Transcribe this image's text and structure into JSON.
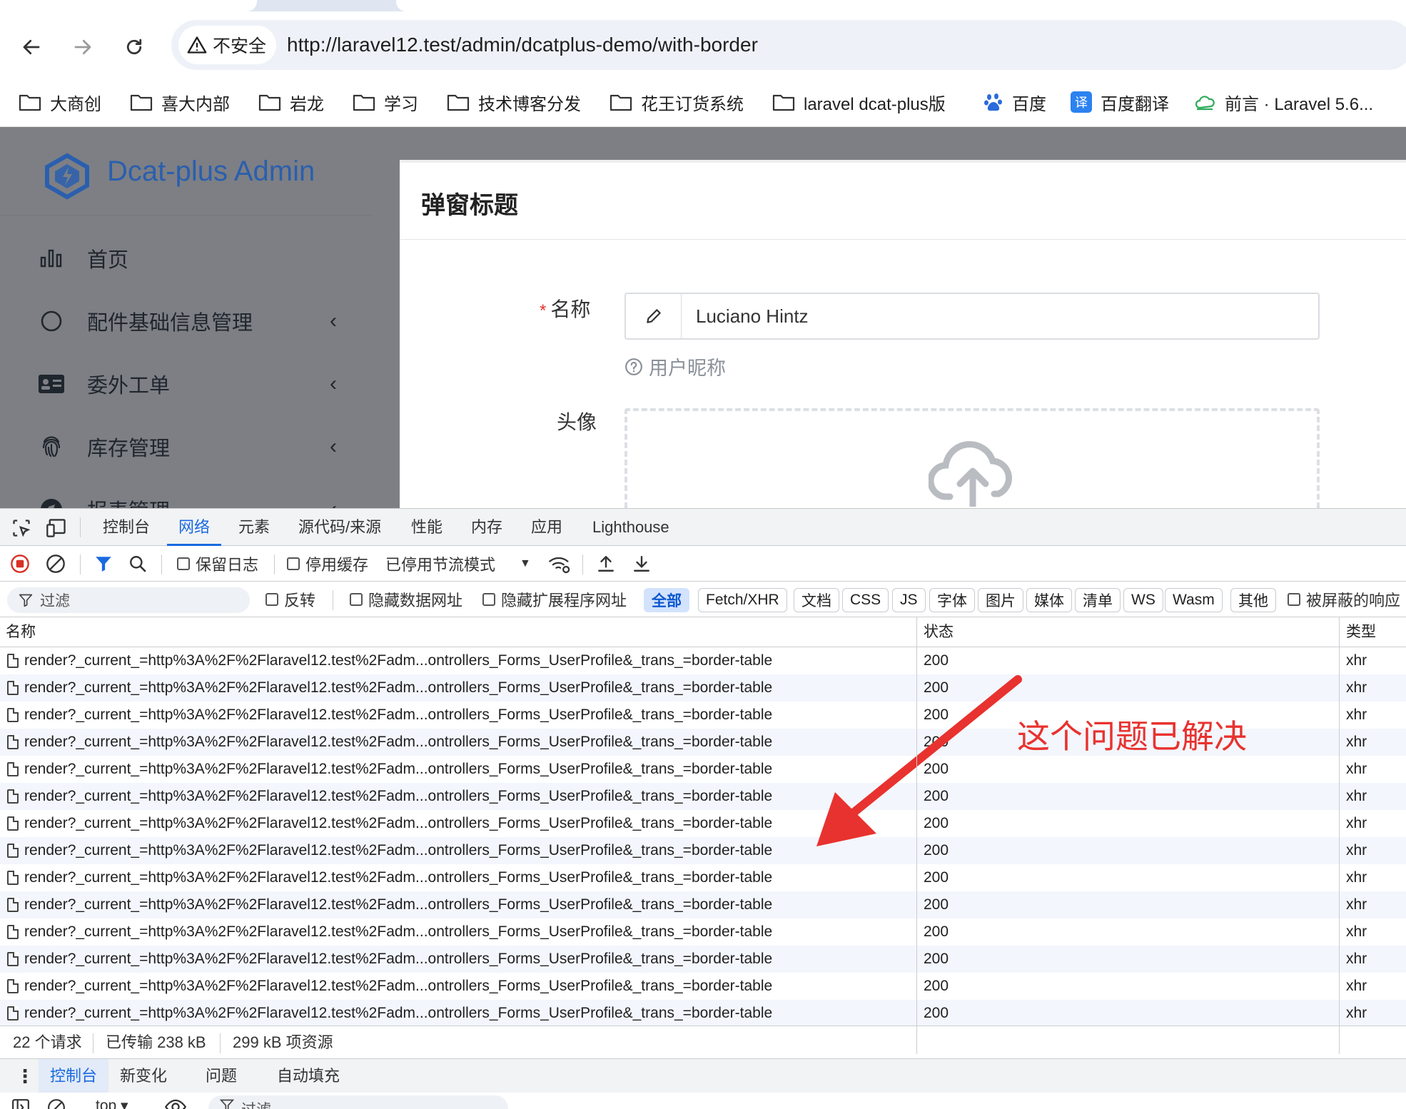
{
  "browser": {
    "security_label": "不安全",
    "url": "http://laravel12.test/admin/dcatplus-demo/with-border",
    "bookmarks": [
      {
        "label": "大商创",
        "icon": "folder-icon"
      },
      {
        "label": "喜大内部",
        "icon": "folder-icon"
      },
      {
        "label": "岩龙",
        "icon": "folder-icon"
      },
      {
        "label": "学习",
        "icon": "folder-icon"
      },
      {
        "label": "技术博客分发",
        "icon": "folder-icon"
      },
      {
        "label": "花王订货系统",
        "icon": "folder-icon"
      },
      {
        "label": "laravel dcat-plus版",
        "icon": "folder-icon"
      },
      {
        "label": "百度",
        "icon": "baidu-icon"
      },
      {
        "label": "百度翻译",
        "icon": "translate-icon"
      },
      {
        "label": "前言 · Laravel 5.6...",
        "icon": "cloud-icon"
      }
    ]
  },
  "app": {
    "brand": "Dcat-plus Admin",
    "menu": [
      {
        "label": "首页",
        "icon": "bar-chart-icon",
        "has_children": false
      },
      {
        "label": "配件基础信息管理",
        "icon": "circle-icon",
        "has_children": true
      },
      {
        "label": "委外工单",
        "icon": "id-card-icon",
        "has_children": true
      },
      {
        "label": "库存管理",
        "icon": "fingerprint-icon",
        "has_children": true
      },
      {
        "label": "报表管理",
        "icon": "compass-icon",
        "has_children": true
      }
    ],
    "chevron": "‹"
  },
  "modal": {
    "title": "弹窗标题",
    "name_label": "名称",
    "required_mark": "*",
    "name_value": "Luciano Hintz",
    "help_text": "用户昵称",
    "avatar_label": "头像"
  },
  "devtools": {
    "tabs": [
      "控制台",
      "网络",
      "元素",
      "源代码/来源",
      "性能",
      "内存",
      "应用",
      "Lighthouse"
    ],
    "active_tab": "网络",
    "toolbar": {
      "preserve_log": "保留日志",
      "disable_cache": "停用缓存",
      "throttling": "已停用节流模式"
    },
    "filter": {
      "placeholder": "过滤",
      "invert": "反转",
      "hide_data_urls": "隐藏数据网址",
      "hide_extension_urls": "隐藏扩展程序网址",
      "types": [
        "全部",
        "Fetch/XHR",
        "文档",
        "CSS",
        "JS",
        "字体",
        "图片",
        "媒体",
        "清单",
        "WS",
        "Wasm",
        "其他"
      ],
      "active_type": "全部",
      "blocked_responses": "被屏蔽的响应"
    },
    "columns": {
      "name": "名称",
      "status": "状态",
      "type": "类型"
    },
    "rows": [
      {
        "name": "render?_current_=http%3A%2F%2Flaravel12.test%2Fadm...ontrollers_Forms_UserProfile&_trans_=border-table",
        "status": "200",
        "type": "xhr"
      },
      {
        "name": "render?_current_=http%3A%2F%2Flaravel12.test%2Fadm...ontrollers_Forms_UserProfile&_trans_=border-table",
        "status": "200",
        "type": "xhr"
      },
      {
        "name": "render?_current_=http%3A%2F%2Flaravel12.test%2Fadm...ontrollers_Forms_UserProfile&_trans_=border-table",
        "status": "200",
        "type": "xhr"
      },
      {
        "name": "render?_current_=http%3A%2F%2Flaravel12.test%2Fadm...ontrollers_Forms_UserProfile&_trans_=border-table",
        "status": "200",
        "type": "xhr"
      },
      {
        "name": "render?_current_=http%3A%2F%2Flaravel12.test%2Fadm...ontrollers_Forms_UserProfile&_trans_=border-table",
        "status": "200",
        "type": "xhr"
      },
      {
        "name": "render?_current_=http%3A%2F%2Flaravel12.test%2Fadm...ontrollers_Forms_UserProfile&_trans_=border-table",
        "status": "200",
        "type": "xhr"
      },
      {
        "name": "render?_current_=http%3A%2F%2Flaravel12.test%2Fadm...ontrollers_Forms_UserProfile&_trans_=border-table",
        "status": "200",
        "type": "xhr"
      },
      {
        "name": "render?_current_=http%3A%2F%2Flaravel12.test%2Fadm...ontrollers_Forms_UserProfile&_trans_=border-table",
        "status": "200",
        "type": "xhr"
      },
      {
        "name": "render?_current_=http%3A%2F%2Flaravel12.test%2Fadm...ontrollers_Forms_UserProfile&_trans_=border-table",
        "status": "200",
        "type": "xhr"
      },
      {
        "name": "render?_current_=http%3A%2F%2Flaravel12.test%2Fadm...ontrollers_Forms_UserProfile&_trans_=border-table",
        "status": "200",
        "type": "xhr"
      },
      {
        "name": "render?_current_=http%3A%2F%2Flaravel12.test%2Fadm...ontrollers_Forms_UserProfile&_trans_=border-table",
        "status": "200",
        "type": "xhr"
      },
      {
        "name": "render?_current_=http%3A%2F%2Flaravel12.test%2Fadm...ontrollers_Forms_UserProfile&_trans_=border-table",
        "status": "200",
        "type": "xhr"
      },
      {
        "name": "render?_current_=http%3A%2F%2Flaravel12.test%2Fadm...ontrollers_Forms_UserProfile&_trans_=border-table",
        "status": "200",
        "type": "xhr"
      },
      {
        "name": "render?_current_=http%3A%2F%2Flaravel12.test%2Fadm...ontrollers_Forms_UserProfile&_trans_=border-table",
        "status": "200",
        "type": "xhr"
      }
    ],
    "summary": {
      "requests": "22 个请求",
      "transferred": "已传输 238 kB",
      "resources": "299 kB 项资源"
    },
    "drawer_tabs": [
      "控制台",
      "新变化",
      "问题",
      "自动填充"
    ],
    "active_drawer_tab": "控制台",
    "console": {
      "context": "top ▾",
      "filter_placeholder": "过滤"
    }
  },
  "annotation": {
    "text": "这个问题已解决",
    "color": "#e8322f"
  }
}
